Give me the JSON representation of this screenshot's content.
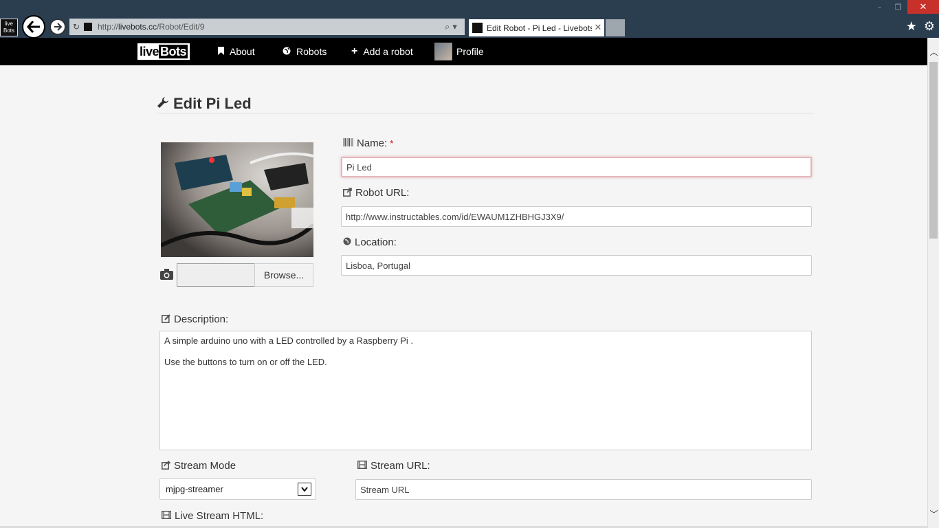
{
  "browser": {
    "url_prefix": "http://",
    "url_host": "livebots.cc",
    "url_path": "/Robot/Edit/9",
    "tab_title": "Edit Robot - Pi Led - Livebots",
    "app_logo_top": "live",
    "app_logo_bottom": "Bots",
    "window_buttons": {
      "minimize": "–",
      "restore": "❐",
      "close": "✕"
    },
    "icons": [
      "back-arrow-icon",
      "forward-arrow-icon",
      "refresh-icon",
      "search-icon",
      "star-icon",
      "gear-icon"
    ]
  },
  "navbar": {
    "brand_live": "live",
    "brand_bots": "Bots",
    "items": [
      {
        "label": "About",
        "icon": "bookmark-icon"
      },
      {
        "label": "Robots",
        "icon": "globe-icon"
      },
      {
        "label": "Add a robot",
        "icon": "plus-icon"
      },
      {
        "label": "Profile",
        "icon": "avatar"
      }
    ]
  },
  "page": {
    "title": "Edit Pi Led",
    "browse_label": "Browse..."
  },
  "form": {
    "name_label": "Name:",
    "name_required": "*",
    "name_value": "Pi Led",
    "url_label": "Robot URL:",
    "url_value": "http://www.instructables.com/id/EWAUM1ZHBHGJ3X9/",
    "location_label": "Location:",
    "location_value": "Lisboa, Portugal",
    "description_label": "Description:",
    "description_lines": [
      "A simple arduino uno with a LED controlled by a Raspberry Pi .",
      "Use the buttons to turn on or off the LED."
    ],
    "stream_mode_label": "Stream Mode",
    "stream_mode_value": "mjpg-streamer",
    "stream_url_label": "Stream URL:",
    "stream_url_placeholder": "Stream URL",
    "live_stream_label": "Live Stream HTML:"
  },
  "colors": {
    "chrome": "#2b3e50",
    "navbar": "#000000",
    "page_bg": "#f5f5f5",
    "required": "#cc0000",
    "focus_border": "#e5b7bb"
  }
}
